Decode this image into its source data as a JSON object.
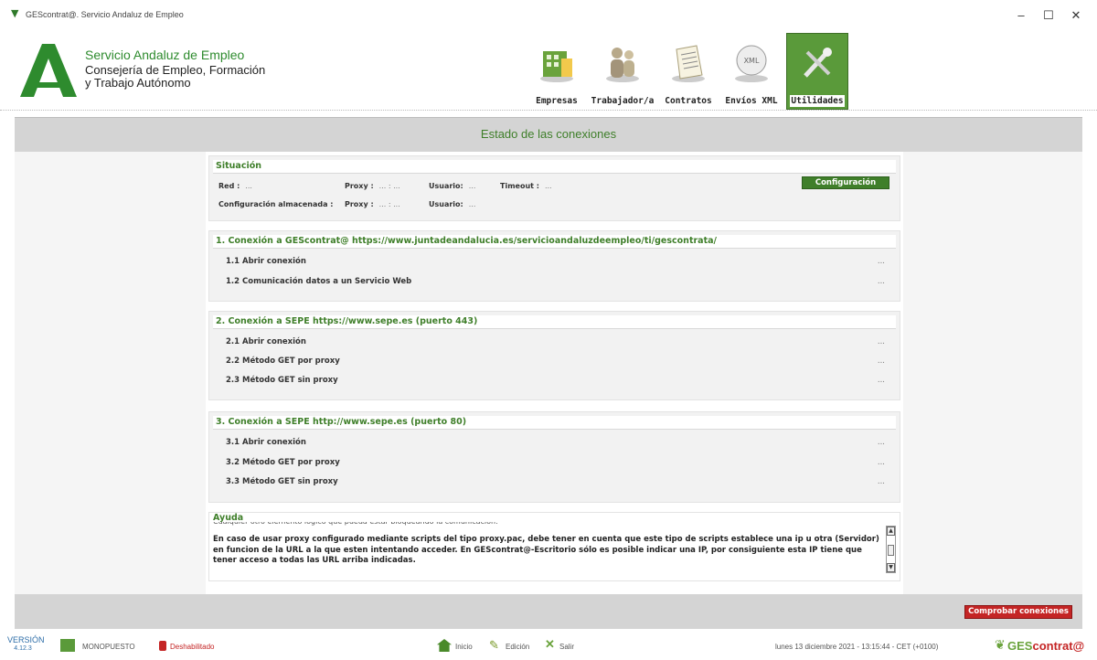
{
  "window": {
    "title": "GEScontrat@. Servicio Andaluz de Empleo",
    "minimize": "–",
    "maximize": "☐",
    "close": "✕"
  },
  "brand": {
    "line1": "Servicio Andaluz de Empleo",
    "line2": "Consejería de Empleo, Formación",
    "line3": "y Trabajo Autónomo",
    "logo_color": "#2e8b2e"
  },
  "nav": [
    {
      "label": "Empresas",
      "icon": "building-icon"
    },
    {
      "label": "Trabajador/a",
      "icon": "people-icon"
    },
    {
      "label": "Contratos",
      "icon": "document-icon"
    },
    {
      "label": "Envíos XML",
      "icon": "xml-icon"
    },
    {
      "label": "Utilidades",
      "icon": "tools-icon",
      "active": true
    }
  ],
  "page": {
    "title": "Estado de las conexiones"
  },
  "situacion": {
    "title": "Situación",
    "red_label": "Red :",
    "red_value": "...",
    "proxy_label": "Proxy :",
    "proxy_value": "... : ...",
    "usuario_label": "Usuario:",
    "usuario_value": "...",
    "timeout_label": "Timeout :",
    "timeout_value": "...",
    "config_button": "Configuración",
    "stored_label": "Configuración almacenada :",
    "stored_proxy_label": "Proxy :",
    "stored_proxy_value": "... : ...",
    "stored_usuario_label": "Usuario:",
    "stored_usuario_value": "..."
  },
  "sections": [
    {
      "title": "1. Conexión a GEScontrat@ https://www.juntadeandalucia.es/servicioandaluzdeempleo/ti/gescontrata/",
      "rows": [
        {
          "label": "1.1 Abrir conexión",
          "status": "..."
        },
        {
          "label": "1.2 Comunicación datos a un Servicio Web",
          "status": "..."
        }
      ]
    },
    {
      "title": "2. Conexión a SEPE https://www.sepe.es (puerto 443)",
      "rows": [
        {
          "label": "2.1 Abrir conexión",
          "status": "..."
        },
        {
          "label": "2.2 Método GET por proxy",
          "status": "..."
        },
        {
          "label": "2.3 Método GET sin proxy",
          "status": "..."
        }
      ]
    },
    {
      "title": "3. Conexión a  SEPE  http://www.sepe.es (puerto 80)",
      "rows": [
        {
          "label": "3.1 Abrir conexión",
          "status": "..."
        },
        {
          "label": "3.2 Método GET por proxy",
          "status": "..."
        },
        {
          "label": "3.3 Método GET sin proxy",
          "status": "..."
        }
      ]
    }
  ],
  "ayuda": {
    "title": "Ayuda",
    "cut_line": "Cualquier otro elemento lógico que pueda estar bloqueando la comunicación.",
    "text": "En caso de usar proxy configurado mediante scripts del tipo proxy.pac, debe tener en cuenta que este tipo de scripts establece una ip u otra (Servidor) en funcion de la URL a la que esten intentando acceder. En GEScontrat@-Escritorio sólo es posible indicar una IP, por consiguiente esta IP tiene que tener acceso a todas las URL arriba indicadas."
  },
  "actions": {
    "check_button": "Comprobar conexiones"
  },
  "statusbar": {
    "version_label": "VERSIÓN",
    "version": "4.12.3",
    "mode": "MONOPUESTO",
    "disabled": "Deshabilitado",
    "inicio": "Inicio",
    "edicion": "Edición",
    "salir": "Salir",
    "datetime": "lunes 13 diciembre 2021 - 13:15:44 - CET (+0100)",
    "logo_prefix": "GES",
    "logo_suffix": "contrat@"
  },
  "colors": {
    "accent_green": "#3f7f2a",
    "danger_red": "#c42525",
    "bar_gray": "#d4d4d4"
  }
}
